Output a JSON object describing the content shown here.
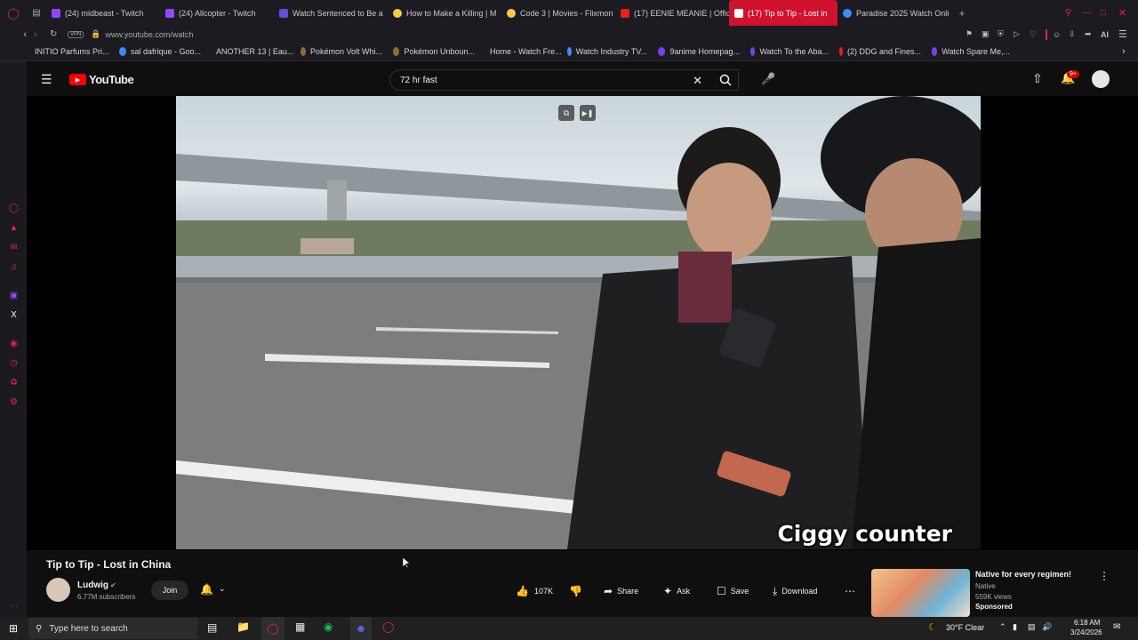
{
  "browser": {
    "tabs": [
      {
        "label": "(24) midbeast - Twitch",
        "color": "#9146ff"
      },
      {
        "label": "(24) Allcopter - Twitch",
        "color": "#9146ff"
      },
      {
        "label": "Watch Sentenced to Be a",
        "color": "#6a4bd6"
      },
      {
        "label": "How to Make a Killing | M",
        "color": "#f7c948"
      },
      {
        "label": "Code 3 | Movies - Flixmon",
        "color": "#f7c948"
      },
      {
        "label": "(17) EENIE MEANIE | Offic",
        "color": "#e62117"
      },
      {
        "label": "(17) Tip to Tip - Lost in",
        "color": "#ff0000"
      },
      {
        "label": "Paradise 2025 Watch Onli",
        "color": "#3d8bfd"
      }
    ],
    "address": "www.youtube.com/watch",
    "vpn_label": "VPN",
    "ai_label": "AI",
    "bookmarks": [
      {
        "label": "INITIO Parfums Pri...",
        "color": "#555"
      },
      {
        "label": "sal dafrique - Goo...",
        "color": "#4285f4"
      },
      {
        "label": "ANOTHER 13 | Eau...",
        "color": "#777"
      },
      {
        "label": "Pokémon Volt Whi...",
        "color": "#8a6d3b"
      },
      {
        "label": "Pokémon Unboun...",
        "color": "#8a6d3b"
      },
      {
        "label": "Home - Watch Fre...",
        "color": "#5b5b5b"
      },
      {
        "label": "Watch Industry TV...",
        "color": "#3d8bfd"
      },
      {
        "label": "9anime Homepag...",
        "color": "#7b3fe4"
      },
      {
        "label": "Watch To the Aba...",
        "color": "#7b3fe4"
      },
      {
        "label": "(2) DDG and Fines...",
        "color": "#e62117"
      },
      {
        "label": "Watch Spare Me,...",
        "color": "#7b3fe4"
      }
    ]
  },
  "youtube": {
    "logo_text": "YouTube",
    "search_value": "72 hr fast",
    "notif_count": "9+"
  },
  "video": {
    "caption": "Ciggy counter",
    "title": "Tip to Tip - Lost in China"
  },
  "channel": {
    "name": "Ludwig",
    "subscribers": "6.77M subscribers",
    "join_label": "Join"
  },
  "actions": {
    "likes": "107K",
    "share": "Share",
    "ask": "Ask",
    "save": "Save",
    "download": "Download"
  },
  "ad": {
    "title": "Native for every regimen!",
    "advertiser": "Native",
    "views": "559K views",
    "sponsored": "Sponsored"
  },
  "taskbar": {
    "search_placeholder": "Type here to search",
    "weather": "30°F  Clear",
    "time": "6:18 AM",
    "date": "3/24/2026"
  },
  "colors": {
    "accent": "#ff0000",
    "browser_bg": "#1c1b22"
  }
}
